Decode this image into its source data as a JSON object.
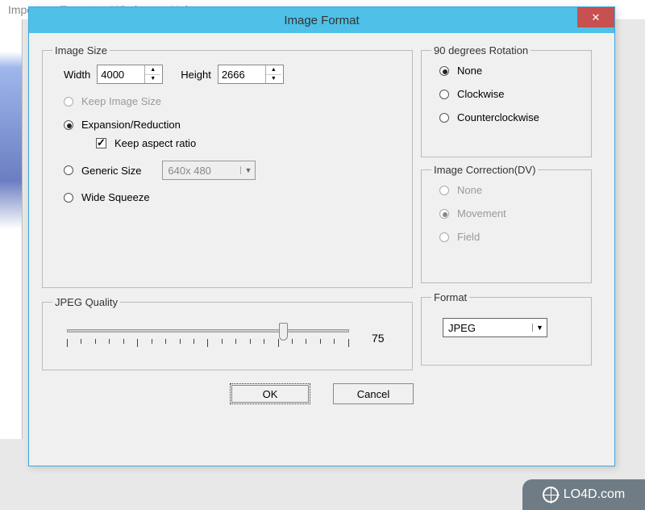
{
  "menubar": {
    "items": [
      "Import",
      "Export",
      "Window",
      "Help"
    ]
  },
  "dialog": {
    "title": "Image Format",
    "image_size": {
      "legend": "Image Size",
      "width_label": "Width",
      "width_value": "4000",
      "height_label": "Height",
      "height_value": "2666",
      "keep_image_size": "Keep Image Size",
      "expansion": "Expansion/Reduction",
      "keep_aspect": "Keep aspect ratio",
      "generic_size": "Generic Size",
      "generic_value": "640x 480",
      "wide_squeeze": "Wide Squeeze"
    },
    "rotation": {
      "legend": "90 degrees Rotation",
      "none": "None",
      "cw": "Clockwise",
      "ccw": "Counterclockwise"
    },
    "correction": {
      "legend": "Image Correction(DV)",
      "none": "None",
      "movement": "Movement",
      "field": "Field"
    },
    "quality": {
      "legend": "JPEG Quality",
      "value": "75"
    },
    "format": {
      "legend": "Format",
      "value": "JPEG"
    },
    "buttons": {
      "ok": "OK",
      "cancel": "Cancel"
    }
  },
  "watermark": "LO4D.com"
}
